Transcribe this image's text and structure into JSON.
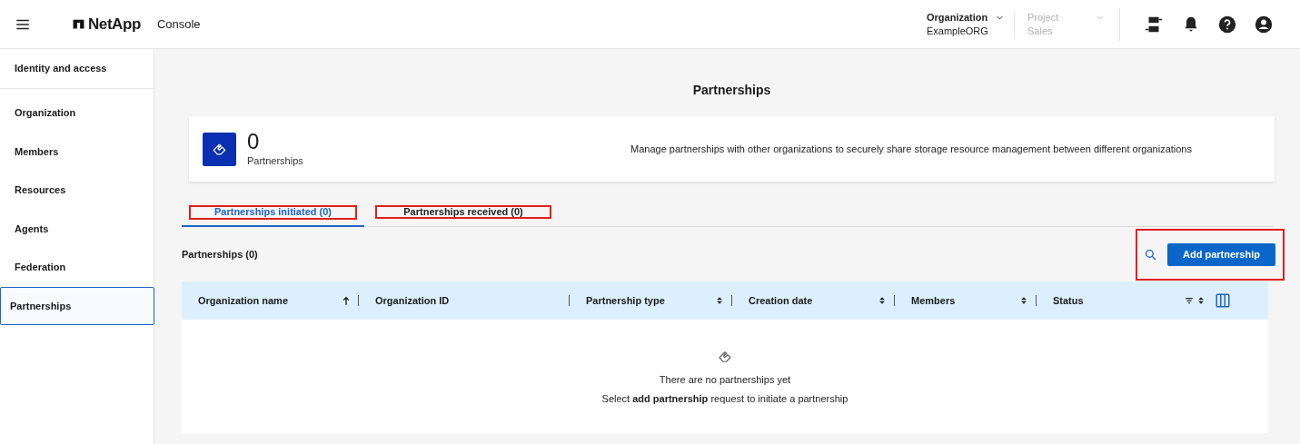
{
  "header": {
    "brand": "NetApp",
    "product": "Console",
    "context": [
      {
        "label": "Organization",
        "value": "ExampleORG",
        "disabled": false
      },
      {
        "label": "Project",
        "value": "Sales",
        "disabled": true
      }
    ]
  },
  "sidebar": {
    "heading": "Identity and access",
    "items": [
      {
        "label": "Organization",
        "selected": false
      },
      {
        "label": "Members",
        "selected": false
      },
      {
        "label": "Resources",
        "selected": false
      },
      {
        "label": "Agents",
        "selected": false
      },
      {
        "label": "Federation",
        "selected": false
      },
      {
        "label": "Partnerships",
        "selected": true
      }
    ]
  },
  "page": {
    "title": "Partnerships",
    "summary": {
      "count": "0",
      "label": "Partnerships",
      "description": "Manage partnerships with other organizations to securely share storage resource management between different organizations"
    }
  },
  "tabs": [
    {
      "label": "Partnerships initiated (0)",
      "selected": true,
      "highlighted": true
    },
    {
      "label": "Partnerships received (0)",
      "selected": false,
      "highlighted": true
    }
  ],
  "toolbar": {
    "title": "Partnerships (0)",
    "button": "Add partnership",
    "highlighted": true
  },
  "table": {
    "columns": [
      {
        "label": "Organization name",
        "sortable": true,
        "sorted": true,
        "filter": false
      },
      {
        "label": "Organization ID",
        "sortable": false,
        "filter": false
      },
      {
        "label": "Partnership type",
        "sortable": true,
        "sorted": false,
        "filter": false
      },
      {
        "label": "Creation date",
        "sortable": true,
        "sorted": false,
        "filter": false
      },
      {
        "label": "Members",
        "sortable": true,
        "sorted": false,
        "filter": false
      },
      {
        "label": "Status",
        "sortable": true,
        "sorted": false,
        "filter": true
      }
    ],
    "empty": {
      "title": "There are no partnerships yet",
      "hint": "Select **add partnership** request to initiate a partnership"
    }
  }
}
